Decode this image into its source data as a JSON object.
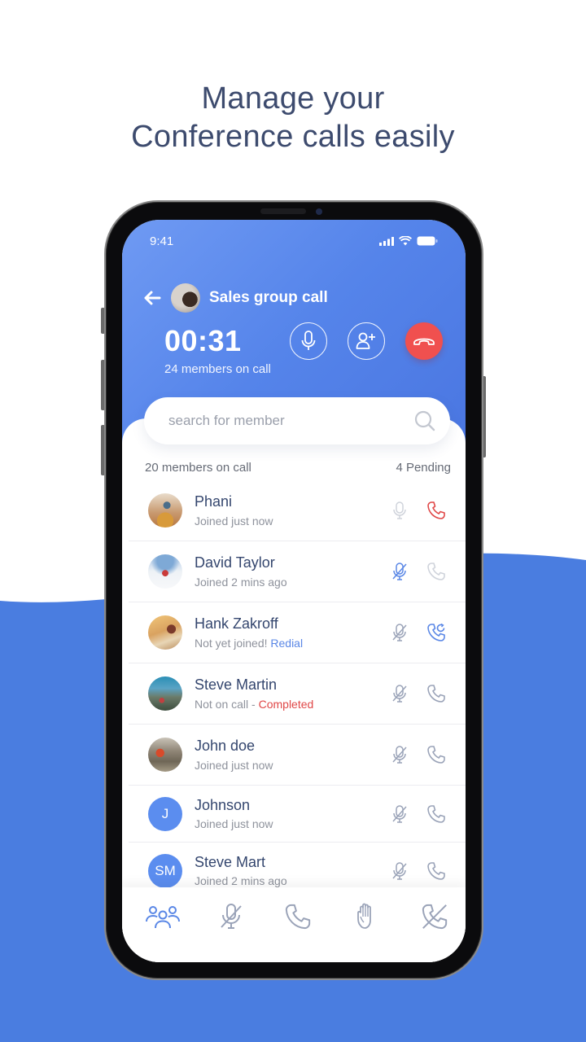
{
  "headline": {
    "line1": "Manage your",
    "line2": "Conference calls easily"
  },
  "colors": {
    "accent": "#4a7de0",
    "headline": "#3d4b6e",
    "end_call": "#f0504f",
    "link_blue": "#5a87e6",
    "link_red": "#e04747",
    "icon_gray": "#9aa3b8"
  },
  "status_bar": {
    "time": "9:41"
  },
  "call": {
    "title": "Sales group call",
    "timer": "00:31",
    "members_on_call": "24 members on call"
  },
  "search": {
    "placeholder": "search for member",
    "value": ""
  },
  "summary": {
    "on_call": "20 members on call",
    "pending": "4 Pending"
  },
  "members": [
    {
      "name": "Phani",
      "status": "Joined just now",
      "status_link": "",
      "link_type": "",
      "avatar": "photo",
      "initials": "",
      "mic": "active-gray",
      "call": "end-red"
    },
    {
      "name": "David Taylor",
      "status": "Joined 2 mins ago",
      "status_link": "",
      "link_type": "",
      "avatar": "photo",
      "initials": "",
      "mic": "muted-blue",
      "call": "light-gray"
    },
    {
      "name": "Hank Zakroff",
      "status": "Not yet joined! ",
      "status_link": "Redial",
      "link_type": "blue",
      "avatar": "photo",
      "initials": "",
      "mic": "muted-gray",
      "call": "redial-blue"
    },
    {
      "name": "Steve Martin",
      "status": "Not on call - ",
      "status_link": "Completed",
      "link_type": "red",
      "avatar": "photo",
      "initials": "",
      "mic": "muted-gray",
      "call": "gray"
    },
    {
      "name": "John doe",
      "status": "Joined just now",
      "status_link": "",
      "link_type": "",
      "avatar": "photo",
      "initials": "",
      "mic": "muted-gray",
      "call": "gray"
    },
    {
      "name": "Johnson",
      "status": "Joined just now",
      "status_link": "",
      "link_type": "",
      "avatar": "initials",
      "initials": "J",
      "mic": "muted-gray",
      "call": "gray"
    },
    {
      "name": "Steve Mart",
      "status": "Joined 2 mins ago",
      "status_link": "",
      "link_type": "",
      "avatar": "initials",
      "initials": "SM",
      "mic": "muted-gray",
      "call": "gray"
    }
  ],
  "bottom_nav": [
    {
      "icon": "participants-icon",
      "active": true
    },
    {
      "icon": "mute-all-icon",
      "active": false
    },
    {
      "icon": "call-icon",
      "active": false
    },
    {
      "icon": "raise-hand-icon",
      "active": false
    },
    {
      "icon": "call-off-icon",
      "active": false
    }
  ]
}
